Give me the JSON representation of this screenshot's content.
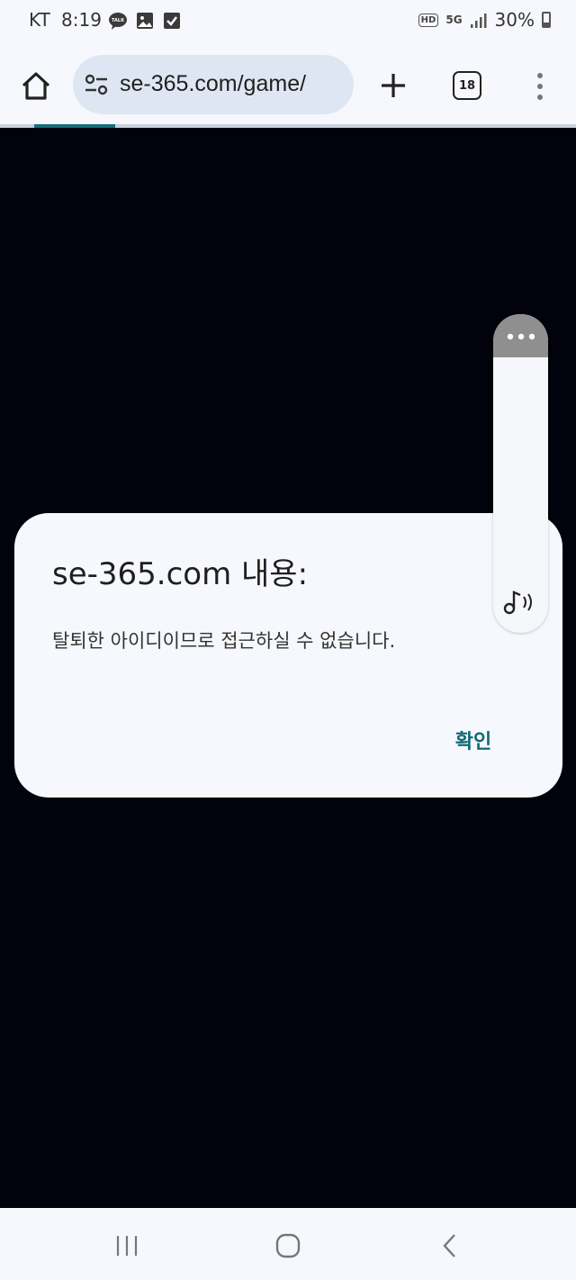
{
  "status_bar": {
    "carrier": "KT",
    "time": "8:19",
    "notification_icons": [
      "talk-icon",
      "image-icon",
      "checkbox-icon"
    ],
    "hd_label": "HD",
    "network_label": "5G",
    "battery": "30%"
  },
  "browser": {
    "url": "se-365.com/game/",
    "tab_count": "18",
    "load_progress": 0.14
  },
  "dialog": {
    "title": "se-365.com 내용:",
    "message": "탈퇴한 아이디이므로 접근하실 수 없습니다.",
    "confirm_label": "확인"
  },
  "colors": {
    "page_background": "#02020c",
    "accent": "#0e6a73",
    "chrome_surface": "#f7f8fd",
    "omnibox": "#dfe6f3"
  }
}
